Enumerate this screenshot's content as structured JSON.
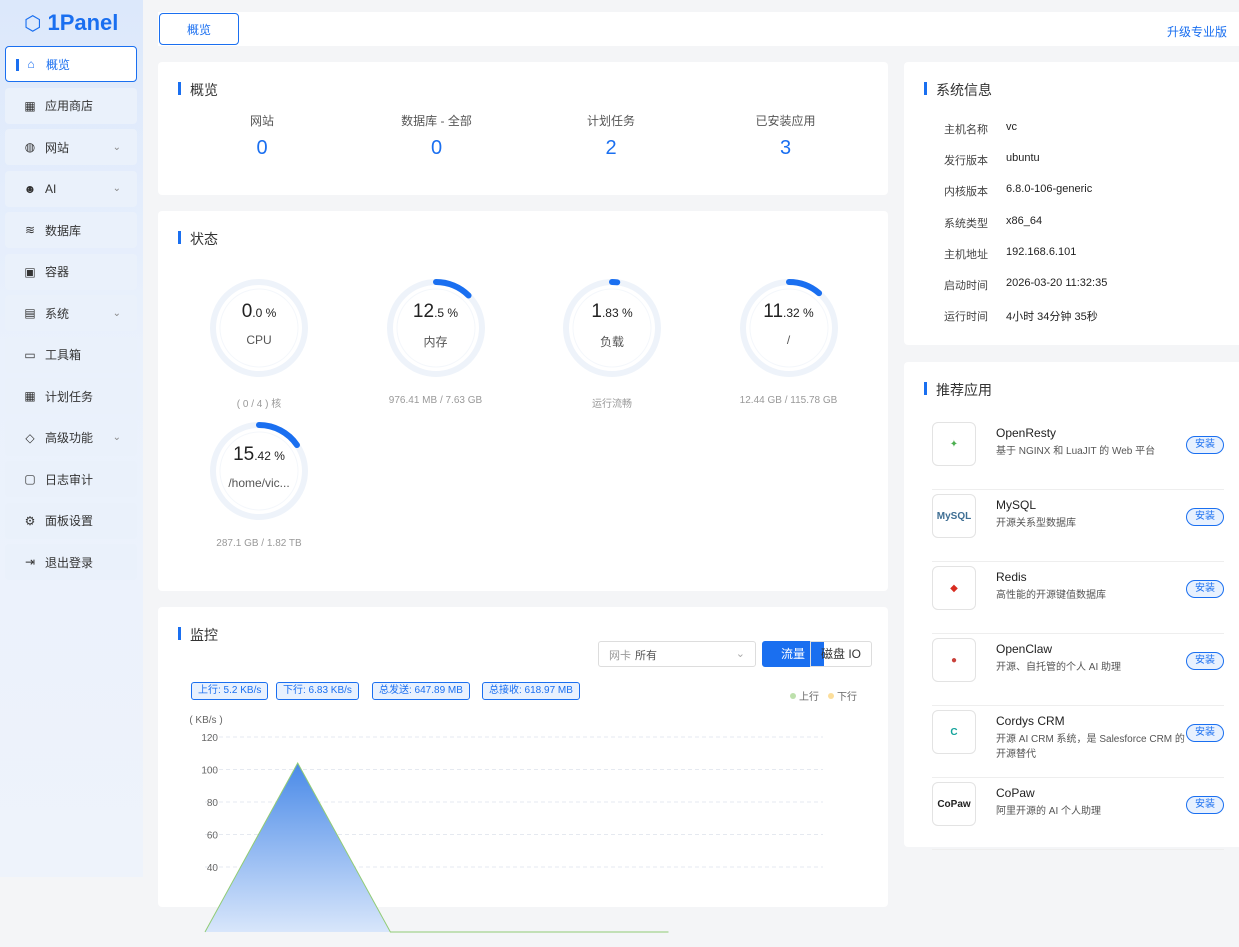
{
  "brand": "1Panel",
  "sidebar": {
    "items": [
      {
        "label": "概览",
        "icon": "home-icon",
        "g": "⌂",
        "active": true
      },
      {
        "label": "应用商店",
        "icon": "grid-icon",
        "g": "▦"
      },
      {
        "label": "网站",
        "icon": "globe-icon",
        "g": "◍",
        "chev": true
      },
      {
        "label": "AI",
        "icon": "robot-icon",
        "g": "☻",
        "chev": true
      },
      {
        "label": "数据库",
        "icon": "layers-icon",
        "g": "≋"
      },
      {
        "label": "容器",
        "icon": "docker-icon",
        "g": "▣"
      },
      {
        "label": "系统",
        "icon": "server-icon",
        "g": "▤",
        "chev": true
      },
      {
        "label": "工具箱",
        "icon": "toolbox-icon",
        "g": "▭"
      },
      {
        "label": "计划任务",
        "icon": "calendar-icon",
        "g": "▦"
      },
      {
        "label": "高级功能",
        "icon": "diamond-icon",
        "g": "◇",
        "chev": true
      },
      {
        "label": "日志审计",
        "icon": "log-icon",
        "g": "▢"
      },
      {
        "label": "面板设置",
        "icon": "gear-icon",
        "g": "⚙"
      },
      {
        "label": "退出登录",
        "icon": "logout-icon",
        "g": "⇥"
      }
    ]
  },
  "topbar": {
    "tab": "概览",
    "upgrade": "升级专业版"
  },
  "overview": {
    "title": "概览",
    "items": [
      {
        "label": "网站",
        "value": "0"
      },
      {
        "label": "数据库 - 全部",
        "value": "0"
      },
      {
        "label": "计划任务",
        "value": "2"
      },
      {
        "label": "已安装应用",
        "value": "3"
      }
    ]
  },
  "status": {
    "title": "状态",
    "gauges": [
      {
        "int": "0",
        "dec": ".0 %",
        "name": "CPU",
        "sub": "( 0 / 4 ) 核",
        "pct": 0
      },
      {
        "int": "12",
        "dec": ".5 %",
        "name": "内存",
        "sub": "976.41 MB / 7.63 GB",
        "pct": 12.5
      },
      {
        "int": "1",
        "dec": ".83 %",
        "name": "负载",
        "sub": "运行流畅",
        "pct": 1.83
      },
      {
        "int": "11",
        "dec": ".32 %",
        "name": "/",
        "sub": "12.44 GB / 115.78 GB",
        "pct": 11.32
      },
      {
        "int": "15",
        "dec": ".42 %",
        "name": "/home/vic...",
        "sub": "287.1 GB / 1.82 TB",
        "pct": 15.42
      }
    ]
  },
  "monitor": {
    "title": "监控",
    "nic_label": "网卡",
    "nic_value": "所有",
    "btn_traffic": "流量",
    "btn_disk": "磁盘 IO",
    "chips": [
      "上行: 5.2 KB/s",
      "下行: 6.83 KB/s",
      "总发送: 647.89 MB",
      "总接收: 618.97 MB"
    ]
  },
  "chart_data": {
    "type": "area",
    "ylabel": "( KB/s )",
    "yticks": [
      40,
      60,
      80,
      100,
      120
    ],
    "ylim": [
      0,
      120
    ],
    "series": [
      {
        "name": "上行",
        "color": "#91cc75",
        "values": [
          0,
          104,
          0,
          0,
          0,
          0
        ]
      },
      {
        "name": "下行",
        "color": "#fac858",
        "values": [
          0,
          0,
          0,
          0,
          0,
          0
        ]
      }
    ]
  },
  "sysinfo": {
    "title": "系统信息",
    "rows": [
      [
        "主机名称",
        "vc"
      ],
      [
        "发行版本",
        "ubuntu"
      ],
      [
        "内核版本",
        "6.8.0-106-generic"
      ],
      [
        "系统类型",
        "x86_64"
      ],
      [
        "主机地址",
        "192.168.6.101"
      ],
      [
        "启动时间",
        "2026-03-20 11:32:35"
      ],
      [
        "运行时间",
        "4小时 34分钟 35秒"
      ]
    ]
  },
  "apps": {
    "title": "推荐应用",
    "install": "安装",
    "items": [
      {
        "name": "OpenResty",
        "desc": "基于 NGINX 和 LuaJIT 的 Web 平台",
        "color": "#4caf50",
        "glyph": "✦"
      },
      {
        "name": "MySQL",
        "desc": "开源关系型数据库",
        "color": "#3e6e93",
        "glyph": "MySQL"
      },
      {
        "name": "Redis",
        "desc": "高性能的开源键值数据库",
        "color": "#d82c20",
        "glyph": "◆"
      },
      {
        "name": "OpenClaw",
        "desc": "开源、自托管的个人 AI 助理",
        "color": "#c9413b",
        "glyph": "●"
      },
      {
        "name": "Cordys CRM",
        "desc": "开源 AI CRM 系统，是 Salesforce CRM 的开源替代",
        "color": "#13a39b",
        "glyph": "C"
      },
      {
        "name": "CoPaw",
        "desc": "阿里开源的 AI 个人助理",
        "color": "#222",
        "glyph": "CoPaw"
      }
    ]
  }
}
